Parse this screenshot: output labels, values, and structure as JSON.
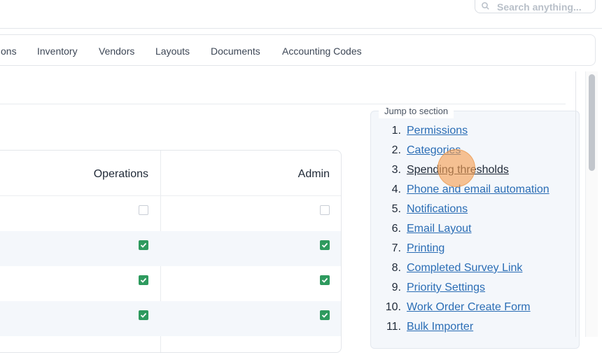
{
  "header": {
    "search": {
      "placeholder": "Search anything..."
    }
  },
  "nav": {
    "tabs": [
      {
        "label": "ons"
      },
      {
        "label": "Inventory"
      },
      {
        "label": "Vendors"
      },
      {
        "label": "Layouts"
      },
      {
        "label": "Documents"
      },
      {
        "label": "Accounting Codes"
      }
    ]
  },
  "table": {
    "columns": [
      "Operations",
      "Admin"
    ],
    "rows": [
      {
        "operations": false,
        "admin": false
      },
      {
        "operations": true,
        "admin": true
      },
      {
        "operations": true,
        "admin": true
      },
      {
        "operations": true,
        "admin": true
      }
    ]
  },
  "jump": {
    "title": "Jump to section",
    "items": [
      {
        "num": "1.",
        "label": "Permissions"
      },
      {
        "num": "2.",
        "label": "Categories"
      },
      {
        "num": "3.",
        "label": "Spending thresholds"
      },
      {
        "num": "4.",
        "label": "Phone and email automation"
      },
      {
        "num": "5.",
        "label": "Notifications"
      },
      {
        "num": "6.",
        "label": "Email Layout"
      },
      {
        "num": "7.",
        "label": "Printing"
      },
      {
        "num": "8.",
        "label": "Completed Survey Link"
      },
      {
        "num": "9.",
        "label": "Priority Settings"
      },
      {
        "num": "10.",
        "label": "Work Order Create Form"
      },
      {
        "num": "11.",
        "label": "Bulk Importer"
      }
    ]
  },
  "colors": {
    "link": "#2a6db5",
    "checkbox_checked": "#2e9a5e",
    "cursor_highlight": "#f59e50"
  }
}
